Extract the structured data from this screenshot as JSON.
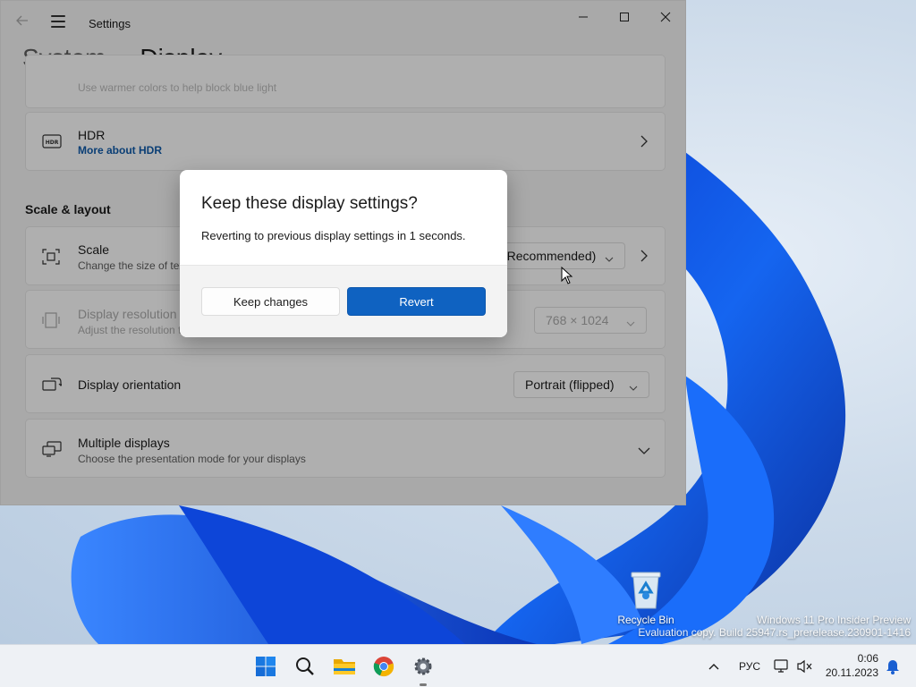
{
  "window": {
    "title": "Settings",
    "breadcrumb": {
      "parent": "System",
      "separator": "›",
      "current": "Display"
    }
  },
  "cards": {
    "night_light_sub": "Use warmer colors to help block blue light",
    "hdr": {
      "title": "HDR",
      "link": "More about HDR"
    },
    "section_scale_layout": "Scale & layout",
    "scale": {
      "title": "Scale",
      "sub": "Change the size of text, apps, and other items",
      "value": "(Recommended)"
    },
    "resolution": {
      "title": "Display resolution",
      "sub": "Adjust the resolution to fit your connected display",
      "value": "768 × 1024"
    },
    "orientation": {
      "title": "Display orientation",
      "value": "Portrait (flipped)"
    },
    "multiple": {
      "title": "Multiple displays",
      "sub": "Choose the presentation mode for your displays"
    }
  },
  "dialog": {
    "title": "Keep these display settings?",
    "message": "Reverting to previous display settings in  1 seconds.",
    "keep_label": "Keep changes",
    "revert_label": "Revert"
  },
  "desktop": {
    "recycle_bin": "Recycle Bin",
    "watermark_line1": "Windows 11 Pro Insider Preview",
    "watermark_line2": "Evaluation copy. Build 25947.rs_prerelease.230901-1416"
  },
  "taskbar": {
    "language": "РУС",
    "time": "0:06",
    "date": "20.11.2023",
    "icons": [
      "windows-start-icon",
      "search-icon",
      "file-explorer-icon",
      "chrome-icon",
      "settings-icon"
    ]
  },
  "colors": {
    "accent": "#0f62c1",
    "link": "#0f5aa8"
  }
}
